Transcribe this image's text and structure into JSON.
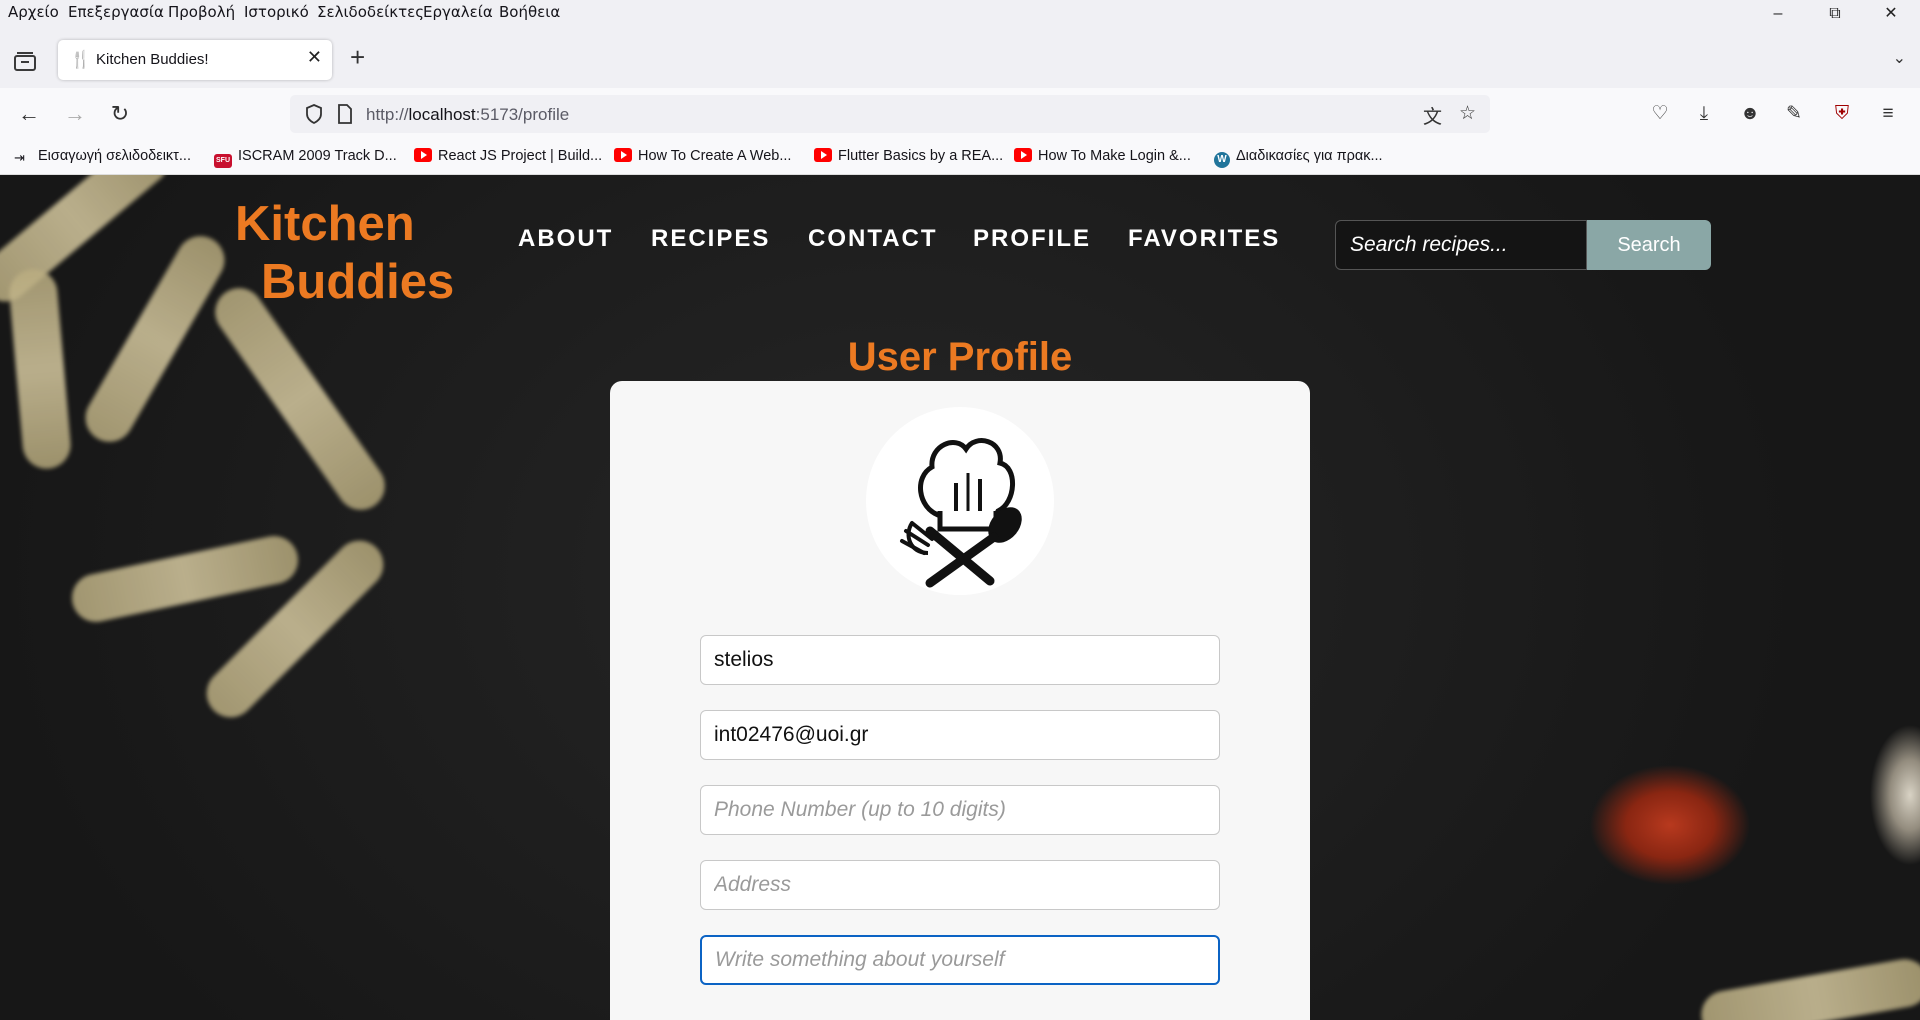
{
  "browser": {
    "menu": [
      "Αρχείο",
      "Επεξεργασία",
      "Προβολή",
      "Ιστορικό",
      "Σελιδοδείκτες",
      "Εργαλεία",
      "Βοήθεια"
    ],
    "tab": {
      "title": "Kitchen Buddies!",
      "icon": "fork-knife-icon"
    },
    "url": {
      "scheme": "http://",
      "host": "localhost",
      "rest": ":5173/profile"
    },
    "bookmarks": [
      {
        "label": "Εισαγωγή σελιδοδεικτ...",
        "icon": "import-icon"
      },
      {
        "label": "ISCRAM 2009 Track D...",
        "icon": "sfu-icon"
      },
      {
        "label": "React JS Project | Build...",
        "icon": "youtube-icon"
      },
      {
        "label": "How To Create A Web...",
        "icon": "youtube-icon"
      },
      {
        "label": "Flutter Basics by a REA...",
        "icon": "youtube-icon"
      },
      {
        "label": "How To Make Login &...",
        "icon": "youtube-icon"
      },
      {
        "label": "Διαδικασίες για πρακ...",
        "icon": "wordpress-icon"
      }
    ]
  },
  "site": {
    "logo_line1": "Kitchen",
    "logo_line2": "Buddies",
    "nav": [
      "ABOUT",
      "RECIPES",
      "CONTACT",
      "PROFILE",
      "FAVORITES"
    ],
    "search": {
      "placeholder": "Search recipes...",
      "button": "Search"
    },
    "accent": "#ec7a22"
  },
  "profile": {
    "title": "User Profile",
    "username": "stelios",
    "email": "int02476@uoi.gr",
    "phone_placeholder": "Phone Number (up to 10 digits)",
    "address_placeholder": "Address",
    "about_placeholder": "Write something about yourself",
    "avatar": "chef-hat-utensils-icon"
  }
}
